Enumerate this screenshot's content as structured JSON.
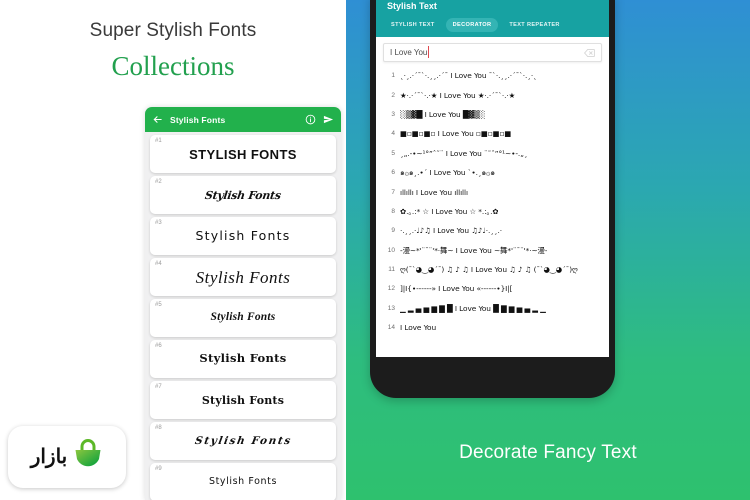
{
  "left": {
    "headline_primary": "Super Stylish Fonts",
    "headline_secondary": "Collections",
    "accent_green": "#22a04e",
    "appbar": {
      "title": "Stylish Fonts",
      "back_icon": "back-arrow-icon",
      "info_icon": "info-icon",
      "send_icon": "send-icon",
      "bg": "#22b14c"
    },
    "font_items": [
      {
        "num": "#1",
        "sample": "STYLISH FONTS"
      },
      {
        "num": "#2",
        "sample": "Stylish Fonts"
      },
      {
        "num": "#3",
        "sample": "Stylish Fonts"
      },
      {
        "num": "#4",
        "sample": "Stylish Fonts"
      },
      {
        "num": "#5",
        "sample": "Stylish Fonts"
      },
      {
        "num": "#6",
        "sample": "Stylish Fonts"
      },
      {
        "num": "#7",
        "sample": "Stylish Fonts"
      },
      {
        "num": "#8",
        "sample": "Stylish Fonts"
      },
      {
        "num": "#9",
        "sample": "Stylish Fonts"
      }
    ],
    "badge": {
      "wordmark": "بازار",
      "bag_icon": "shopping-bag-icon",
      "bag_color": "#3cb825"
    }
  },
  "right": {
    "gradient_top": "#2f8fd4",
    "gradient_bottom": "#2ec16e",
    "appbar": {
      "title": "Stylish Text",
      "bg": "#17a2a2"
    },
    "tabs": [
      {
        "label": "STYLISH TEXT",
        "active": false
      },
      {
        "label": "DECORATOR",
        "active": true
      },
      {
        "label": "TEXT REPEATER",
        "active": false
      }
    ],
    "input": {
      "value": "I Love You",
      "clear_icon": "backspace-clear-icon"
    },
    "decorations": [
      {
        "idx": "1",
        "text": "˛·¸.·´¯`·.¸¸.·´¯ I Love You ¯`·.¸¸.·´¯`·.¸·˛"
      },
      {
        "idx": "2",
        "text": "★·.·´¯`·.·★ I Love You ★·.·´¯`·.·★"
      },
      {
        "idx": "3",
        "text": "░▒▓█ I Love You █▓▒░"
      },
      {
        "idx": "4",
        "text": "■▫■▫■▫ I Love You ▫■▫■▫■"
      },
      {
        "idx": "5",
        "text": "¸„.-•~¹°”ˆ˜¨ I Love You ¨˜ˆ”°¹~•-.„¸"
      },
      {
        "idx": "6",
        "text": "๑۞๑¸.•´ I Love You `•.¸๑۞๑"
      },
      {
        "idx": "7",
        "text": "ıllıllı I Love You ıllıllı"
      },
      {
        "idx": "8",
        "text": "✿.｡.:* ☆ I Love You ☆ *.:｡.✿"
      },
      {
        "idx": "9",
        "text": "·.¸¸.·♩♪♫ I Love You ♫♪♩·.¸¸.·"
      },
      {
        "idx": "10",
        "text": "-漫~*'¨¯¨'*·舞~ I Love You ~舞*'¨¯¨'*·~漫-"
      },
      {
        "idx": "11",
        "text": "ღ(¯`◕‿◕´¯) ♫ ♪ ♫ I Love You ♫ ♪ ♫ (¯`◕‿◕´¯)ღ"
      },
      {
        "idx": "12",
        "text": "]|I{•------» I Love You «------•}I|["
      },
      {
        "idx": "13",
        "text": "▁ ▂ ▄ ▅ ▆ ▇ █ I Love You █ ▇ ▆ ▅ ▄ ▂ ▁"
      },
      {
        "idx": "14",
        "text": "I Love You"
      }
    ],
    "caption": "Decorate Fancy Text"
  }
}
